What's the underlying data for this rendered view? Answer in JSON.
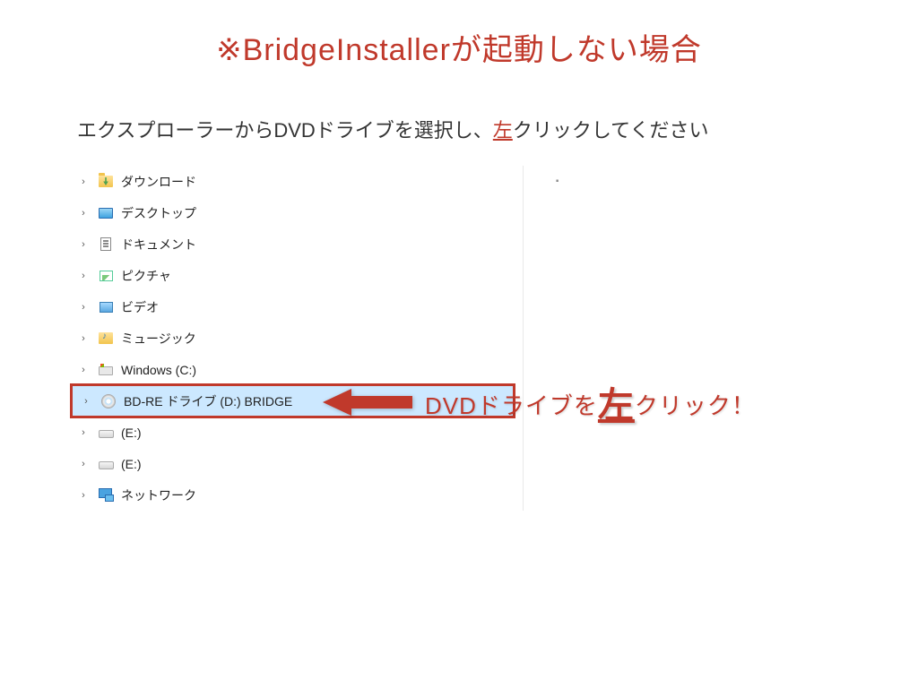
{
  "title": "※BridgeInstallerが起動しない場合",
  "subtitle_pre": "エクスプローラーからDVDドライブを選択し、",
  "subtitle_emph": "左",
  "subtitle_post": "クリックしてください",
  "tree": [
    {
      "label": "ダウンロード",
      "icon": "folder-download"
    },
    {
      "label": "デスクトップ",
      "icon": "desktop"
    },
    {
      "label": "ドキュメント",
      "icon": "doc"
    },
    {
      "label": "ピクチャ",
      "icon": "pic"
    },
    {
      "label": "ビデオ",
      "icon": "video"
    },
    {
      "label": "ミュージック",
      "icon": "music"
    },
    {
      "label": "Windows (C:)",
      "icon": "drive-win"
    },
    {
      "label": "BD-RE ドライブ (D:) BRIDGE",
      "icon": "disc",
      "highlight": true
    },
    {
      "label": "(E:)",
      "icon": "hdd"
    },
    {
      "label": "(E:)",
      "icon": "hdd"
    },
    {
      "label": "ネットワーク",
      "icon": "network"
    }
  ],
  "callout_pre": "DVDドライブを",
  "callout_big": "左",
  "callout_post": "クリック！",
  "colors": {
    "accent": "#c0392b"
  }
}
